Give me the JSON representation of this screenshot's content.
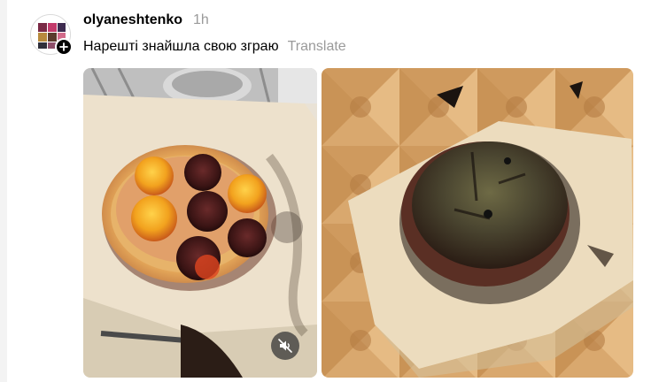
{
  "post": {
    "author": "olyaneshtenko",
    "time": "1h",
    "caption": "Нарешті знайшла свою зграю",
    "translate_label": "Translate"
  },
  "icons": {
    "follow": "plus-icon",
    "mute": "speaker-muted-icon"
  },
  "colors": {
    "text_primary": "#000000",
    "text_secondary": "#9a9a9a",
    "mute_button_bg": "#373737"
  }
}
